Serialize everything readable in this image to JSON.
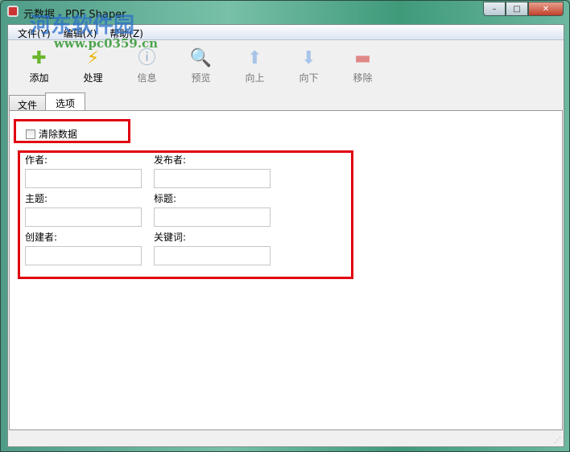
{
  "window": {
    "title": "元数据 - PDF Shaper",
    "min": "–",
    "max": "□",
    "close": "✕"
  },
  "watermark": {
    "name": "河东软件园",
    "url": "www.pc0359.cn"
  },
  "menu": [
    "文件(Y)",
    "编辑(X)",
    "帮助(Z)"
  ],
  "toolbar": [
    {
      "label": "添加",
      "icon": "✚",
      "color": "#6ab62c",
      "enabled": true
    },
    {
      "label": "处理",
      "icon": "⚡",
      "color": "#e8b400",
      "enabled": true
    },
    {
      "label": "信息",
      "icon": "ⓘ",
      "color": "#9ab0cc",
      "enabled": false
    },
    {
      "label": "预览",
      "icon": "🔍",
      "color": "#a0a8b0",
      "enabled": false
    },
    {
      "label": "向上",
      "icon": "⬆",
      "color": "#a8c4e8",
      "enabled": false
    },
    {
      "label": "向下",
      "icon": "⬇",
      "color": "#a8c4e8",
      "enabled": false
    },
    {
      "label": "移除",
      "icon": "▬",
      "color": "#e08888",
      "enabled": false
    }
  ],
  "tabs": [
    "文件",
    "选项"
  ],
  "options": {
    "clear_data": "清除数据",
    "fields": {
      "author": "作者:",
      "publisher": "发布者:",
      "subject": "主题:",
      "title": "标题:",
      "creator": "创建者:",
      "keywords": "关键词:"
    }
  }
}
